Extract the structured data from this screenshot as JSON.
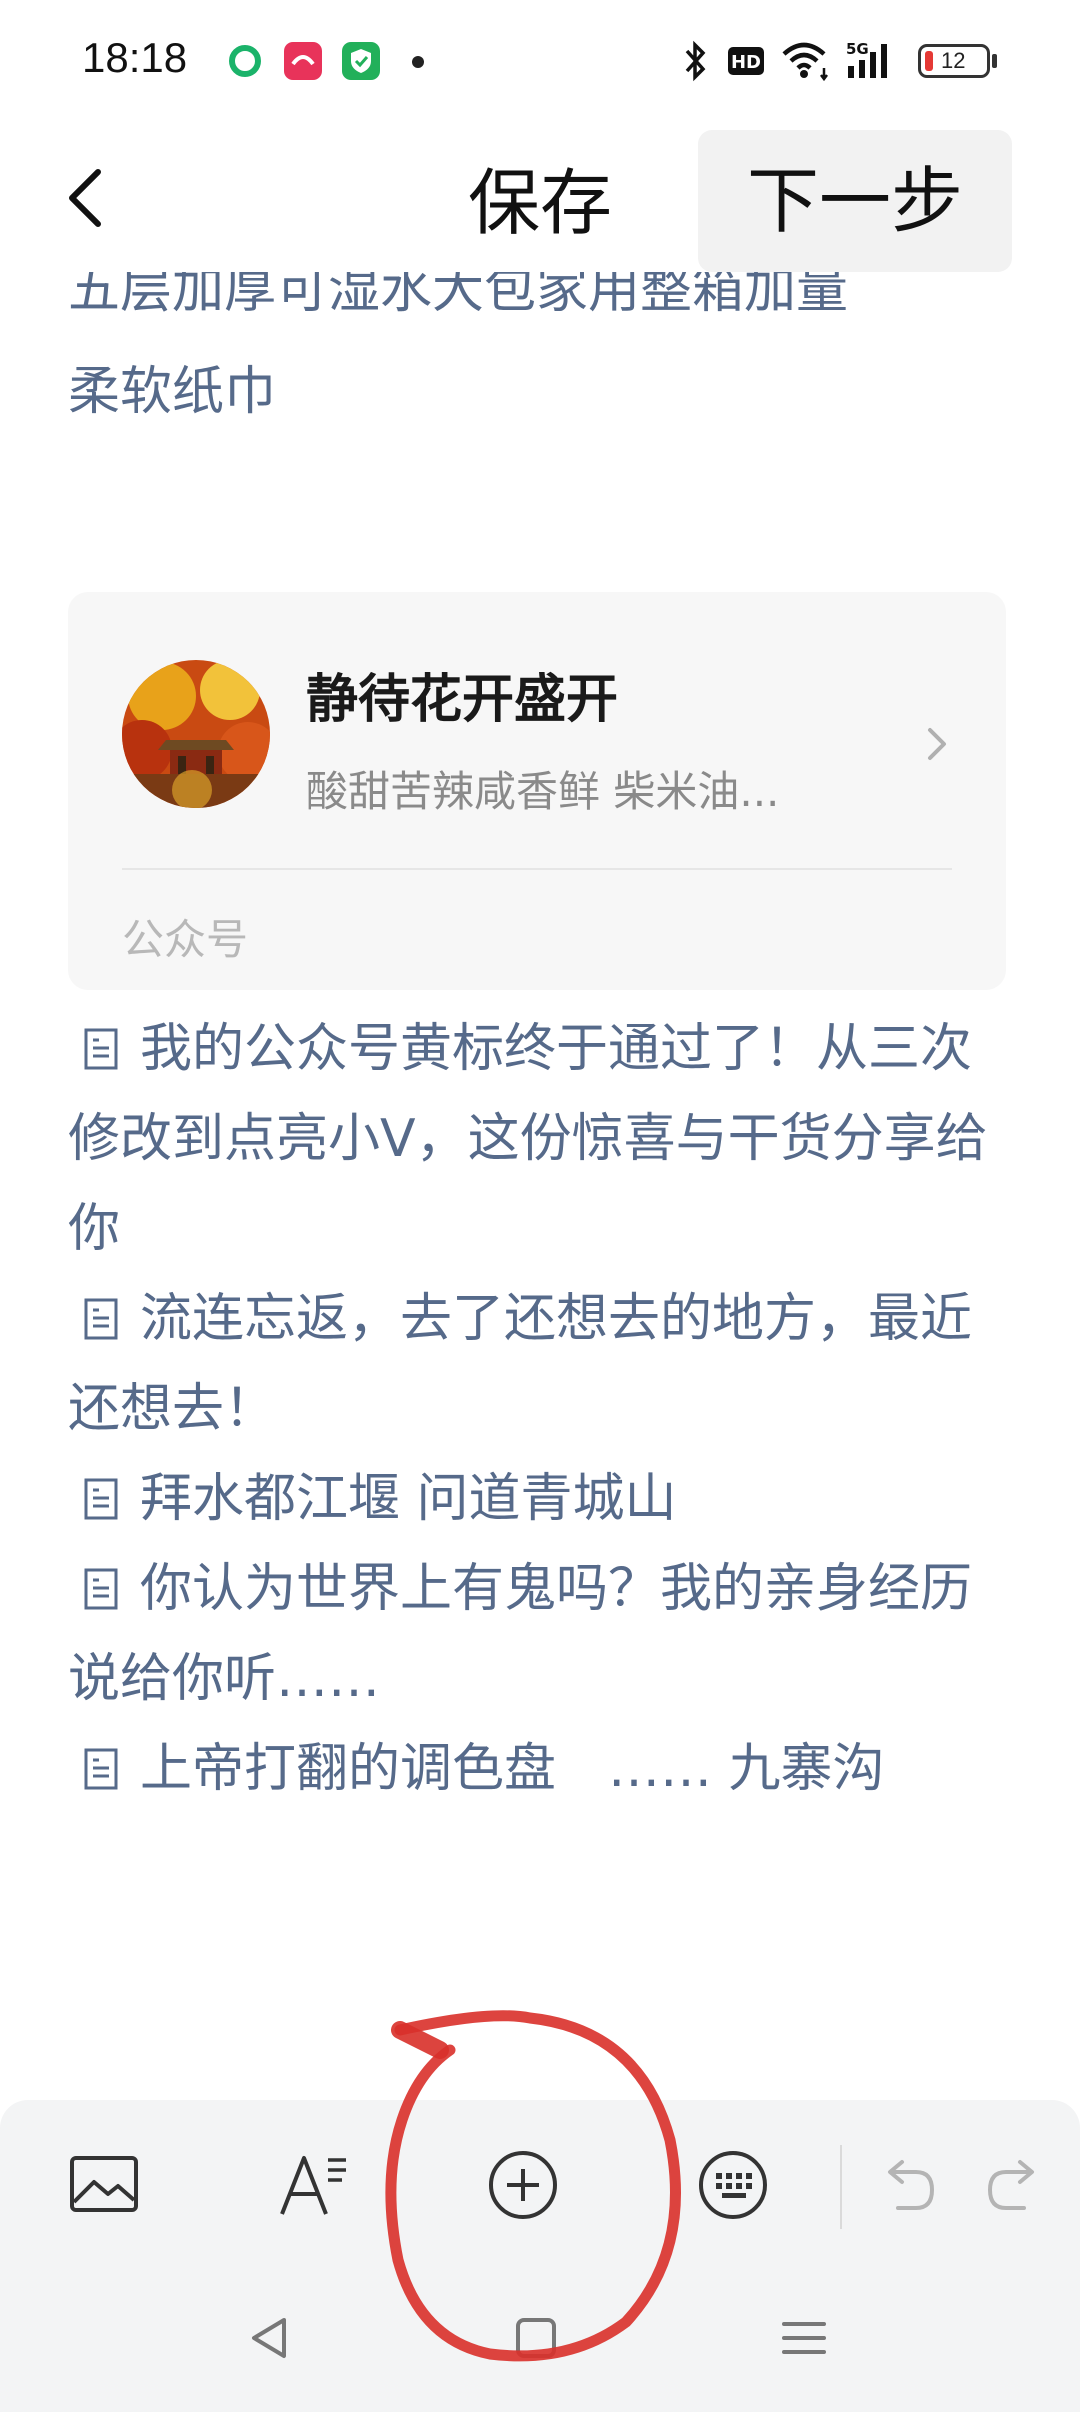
{
  "status_bar": {
    "time": "18:18",
    "battery": "12",
    "network": "5G",
    "hd_label": "HD"
  },
  "nav": {
    "save_label": "保存",
    "next_label": "下一步"
  },
  "article": {
    "partial_line": "五层加厚可湿水大包家用整箱加量",
    "line2": "柔软纸巾"
  },
  "account_card": {
    "name": "静待花开盛开",
    "description": "酸甜苦辣咸香鲜 柴米油...",
    "type_label": "公众号"
  },
  "links": [
    {
      "text": "我的公众号黄标终于通过了！从三次修改到点亮小V，这份惊喜与干货分享给你"
    },
    {
      "text": "流连忘返，去了还想去的地方，最近还想去！"
    },
    {
      "text": "拜水都江堰 问道青城山"
    },
    {
      "text": "你认为世界上有鬼吗？我的亲身经历说给你听……"
    },
    {
      "text": "上帝打翻的调色盘　…… 九寨沟"
    }
  ],
  "toolbar": {
    "icons": [
      "image-icon",
      "text-format-icon",
      "add-icon",
      "keyboard-icon",
      "undo-icon",
      "redo-icon"
    ]
  },
  "colors": {
    "link_text": "#566a8a",
    "annotation_red": "#d9302a",
    "toolbar_bg": "#f3f4f5"
  }
}
